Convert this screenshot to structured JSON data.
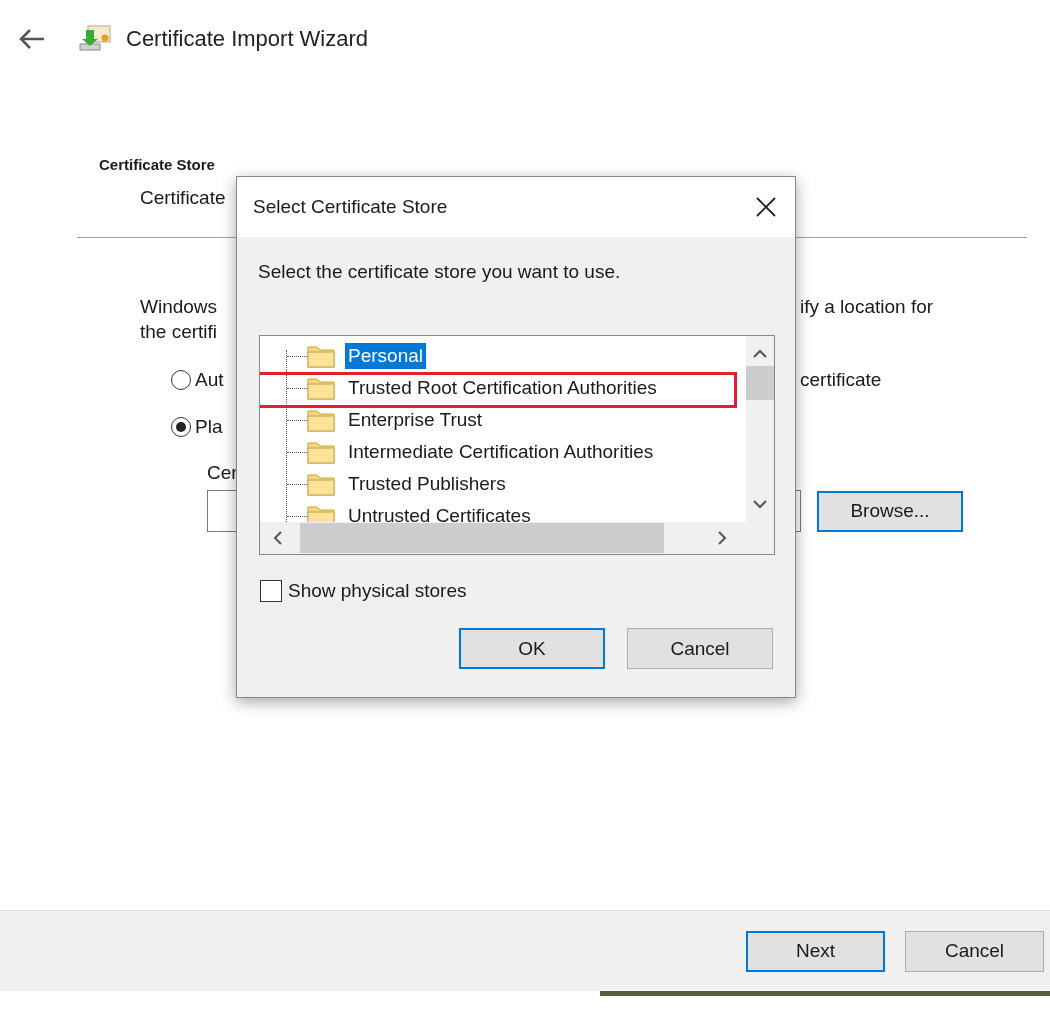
{
  "header": {
    "title": "Certificate Import Wizard"
  },
  "section": {
    "title": "Certificate Store",
    "subtitle": "Certificate"
  },
  "description": {
    "left_lines": [
      "Windows",
      "the certifi"
    ],
    "right_line": "ify a location for"
  },
  "options": [
    {
      "label": "Aut",
      "label_right": "certificate",
      "selected": false
    },
    {
      "label": "Pla",
      "selected": true
    }
  ],
  "store_field": {
    "label": "Cer"
  },
  "browse_button": {
    "label": "Browse...",
    "focused": true
  },
  "footer_buttons": [
    {
      "label": "Next",
      "default": true
    },
    {
      "label": "Cancel",
      "default": false
    }
  ],
  "dialog": {
    "title": "Select Certificate Store",
    "prompt": "Select the certificate store you want to use.",
    "stores": [
      {
        "label": "Personal",
        "selected": true,
        "highlighted": false
      },
      {
        "label": "Trusted Root Certification Authorities",
        "selected": false,
        "highlighted": true
      },
      {
        "label": "Enterprise Trust",
        "selected": false,
        "highlighted": false
      },
      {
        "label": "Intermediate Certification Authorities",
        "selected": false,
        "highlighted": false
      },
      {
        "label": "Trusted Publishers",
        "selected": false,
        "highlighted": false
      },
      {
        "label": "Untrusted Certificates",
        "selected": false,
        "highlighted": false
      }
    ],
    "show_physical": {
      "label": "Show physical stores",
      "checked": false
    },
    "buttons": [
      {
        "label": "OK",
        "default": true
      },
      {
        "label": "Cancel",
        "default": false
      }
    ]
  }
}
